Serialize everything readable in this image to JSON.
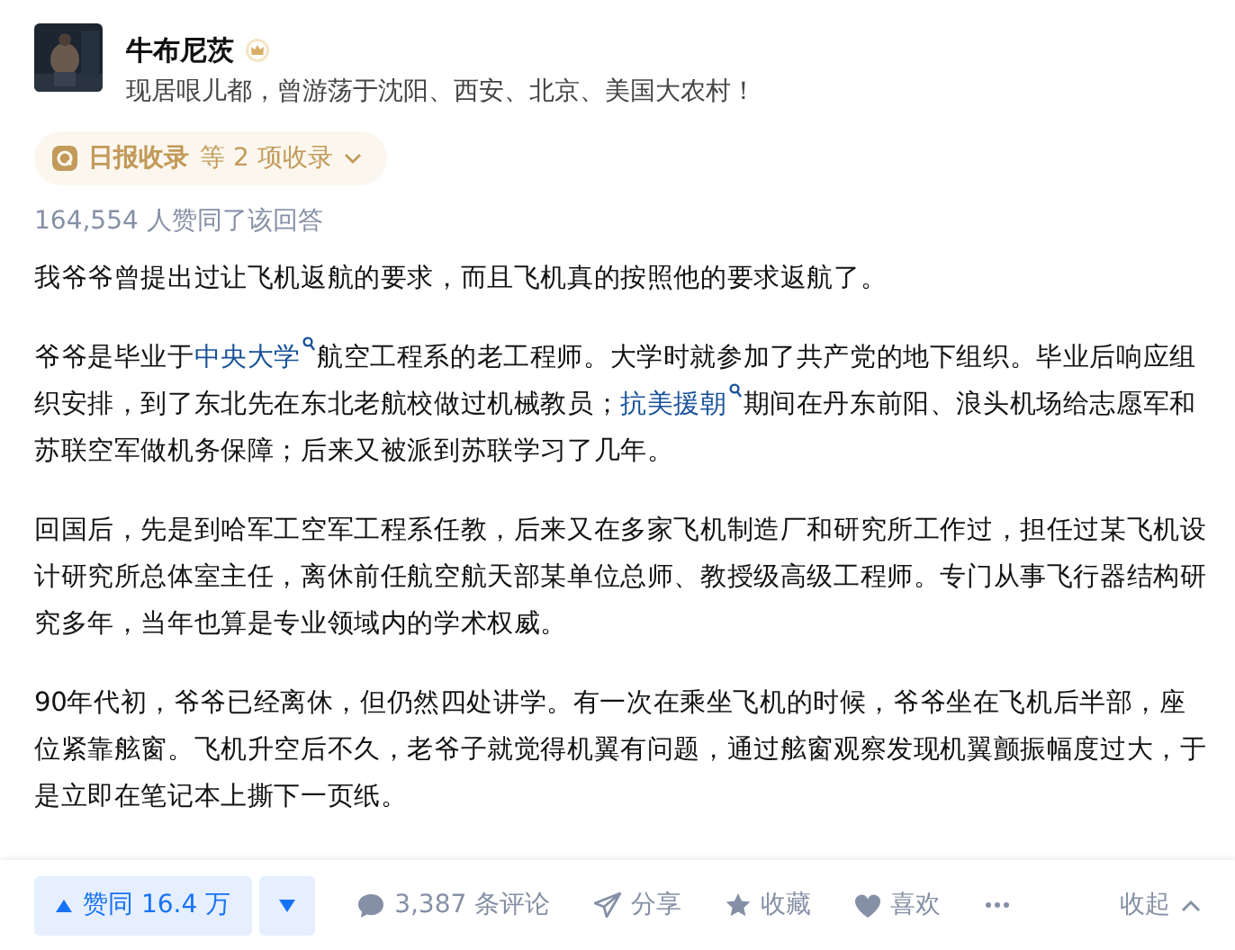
{
  "author": {
    "name": "牛布尼茨",
    "bio": "现居哏儿都，曾游荡于沈阳、西安、北京、美国大农村！"
  },
  "collection_badge": {
    "label": "日报收录",
    "suffix": "等 2 项收录"
  },
  "vote_summary": "164,554 人赞同了该回答",
  "paragraphs": [
    [
      {
        "kind": "text",
        "text": "我爷爷曾提出过让飞机返航的要求，而且飞机真的按照他的要求返航了。"
      }
    ],
    [
      {
        "kind": "text",
        "text": "爷爷是毕业于"
      },
      {
        "kind": "link",
        "text": "中央大学"
      },
      {
        "kind": "text",
        "text": "航空工程系的老工程师。大学时就参加了共产党的地下组织。毕业后响应组织安排，到了东北先在东北老航校做过机械教员；"
      },
      {
        "kind": "link",
        "text": "抗美援朝"
      },
      {
        "kind": "text",
        "text": "期间在丹东前阳、浪头机场给志愿军和苏联空军做机务保障；后来又被派到苏联学习了几年。"
      }
    ],
    [
      {
        "kind": "text",
        "text": "回国后，先是到哈军工空军工程系任教，后来又在多家飞机制造厂和研究所工作过，担任过某飞机设计研究所总体室主任，离休前任航空航天部某单位总师、教授级高级工程师。专门从事飞行器结构研究多年，当年也算是专业领域内的学术权威。"
      }
    ],
    [
      {
        "kind": "text",
        "text": "90年代初，爷爷已经离休，但仍然四处讲学。有一次在乘坐飞机的时候，爷爷坐在飞机后半部，座位紧靠舷窗。飞机升空后不久，老爷子就觉得机翼有问题，通过舷窗观察发现机翼颤振幅度过大，于是立即在笔记本上撕下一页纸。"
      }
    ]
  ],
  "actions": {
    "upvote": "赞同 16.4 万",
    "comments": "3,387 条评论",
    "share": "分享",
    "favorite": "收藏",
    "like": "喜欢",
    "collapse": "收起"
  }
}
